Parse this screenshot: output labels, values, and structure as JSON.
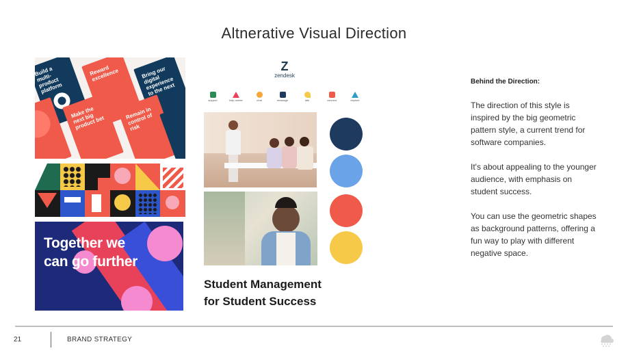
{
  "slide": {
    "title": "Altnerative Visual Direction",
    "page_number": "21",
    "section": "BRAND STRATEGY"
  },
  "moodboard": {
    "posters": [
      "Build a multi-product platform",
      "Reward excellence",
      "Bring our digital experience to the next",
      "Make the next big product bet",
      "Remain in control of risk"
    ],
    "banner_text_line1": "Together we",
    "banner_text_line2": "can go further",
    "brand_name": "zendesk",
    "icon_labels": [
      "support",
      "help center",
      "chat",
      "message",
      "talk",
      "connect",
      "explore"
    ],
    "photo_1": "team-meeting-photo",
    "photo_2": "smiling-student-photo",
    "caption_line1": "Student Management",
    "caption_line2": "for Student Success",
    "palette": [
      "#1f3a5f",
      "#6aa3e8",
      "#f05a4a",
      "#f7c948"
    ]
  },
  "aside": {
    "heading": "Behind the Direction:",
    "paragraph_1": "The direction of this style is inspired by the big geometric pattern style, a current trend for software companies.",
    "paragraph_2": "It's about appealing to the younger audience, with emphasis on student success.",
    "paragraph_3": "You can use the geometric shapes as background patterns, offering a fun way to play with different negative space."
  },
  "icons": {
    "footer_logo": "cloud-rain-icon"
  }
}
